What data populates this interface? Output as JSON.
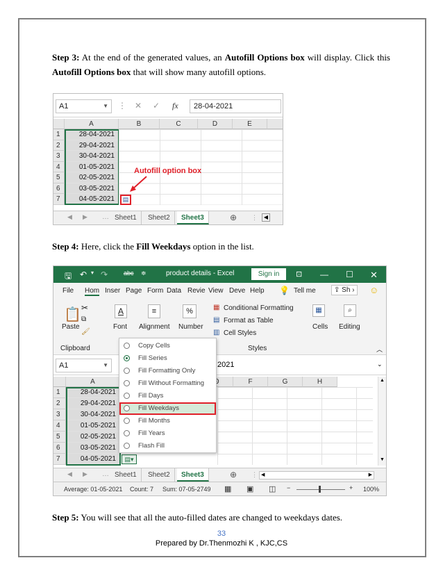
{
  "step3": {
    "label": "Step 3:",
    "text_a": " At the end of the generated values, an ",
    "bold_a": "Autofill Options box",
    "text_b": " will display. Click this ",
    "bold_b": "Autofill Options box",
    "text_c": " that will show many autofill options."
  },
  "shot1": {
    "namebox": "A1",
    "formula": "28-04-2021",
    "columns": [
      "A",
      "B",
      "C",
      "D",
      "E"
    ],
    "rows": [
      "1",
      "2",
      "3",
      "4",
      "5",
      "6",
      "7"
    ],
    "values": [
      "28-04-2021",
      "29-04-2021",
      "30-04-2021",
      "01-05-2021",
      "02-05-2021",
      "03-05-2021",
      "04-05-2021"
    ],
    "annotation": "Autofill option box",
    "tabs": [
      "Sheet1",
      "Sheet2",
      "Sheet3"
    ],
    "accent": "#217346",
    "annotation_color": "#e0212a"
  },
  "step4": {
    "label": "Step 4:",
    "text_a": " Here, click the ",
    "bold_a": "Fill Weekdays",
    "text_b": " option in the list."
  },
  "shot2": {
    "title": "product details  -  Excel",
    "sign_in": "Sign in",
    "undo_icon": "undo-icon",
    "menu": [
      "File",
      "Hom",
      "Inser",
      "Page",
      "Form",
      "Data",
      "Revie",
      "View",
      "Deve",
      "Help"
    ],
    "tell_me": "Tell me",
    "share": "Sh",
    "ribbon": {
      "paste": "Paste",
      "font": "Font",
      "alignment": "Alignment",
      "number": "Number",
      "conditional": "Conditional Formatting",
      "format_table": "Format as Table",
      "cell_styles": "Cell Styles",
      "cells": "Cells",
      "editing": "Editing",
      "clipboard": "Clipboard",
      "styles": "Styles"
    },
    "namebox": "A1",
    "formula_partial": "2021",
    "columns": [
      "A",
      "D",
      "E",
      "F",
      "G",
      "H"
    ],
    "rows": [
      "1",
      "2",
      "3",
      "4",
      "5",
      "6",
      "7"
    ],
    "values": [
      "28-04-2021",
      "29-04-2021",
      "30-04-2021",
      "01-05-2021",
      "02-05-2021",
      "03-05-2021",
      "04-05-2021"
    ],
    "menu_items": [
      "Copy Cells",
      "Fill Series",
      "Fill Formatting Only",
      "Fill Without Formatting",
      "Fill Days",
      "Fill Weekdays",
      "Fill Months",
      "Fill Years",
      "Flash Fill"
    ],
    "selected_item": "Fill Series",
    "highlighted_item": "Fill Weekdays",
    "tabs": [
      "Sheet1",
      "Sheet2",
      "Sheet3"
    ],
    "status": {
      "average": "Average: 01-05-2021",
      "count": "Count: 7",
      "sum": "Sum: 07-05-2749",
      "zoom": "100%"
    }
  },
  "step5": {
    "label": "Step 5:",
    "text": " You will see that all the auto-filled dates are changed to weekdays dates."
  },
  "footer": {
    "page_number": "33",
    "prepared_by": "Prepared by  Dr.Thenmozhi K , KJC,CS"
  }
}
